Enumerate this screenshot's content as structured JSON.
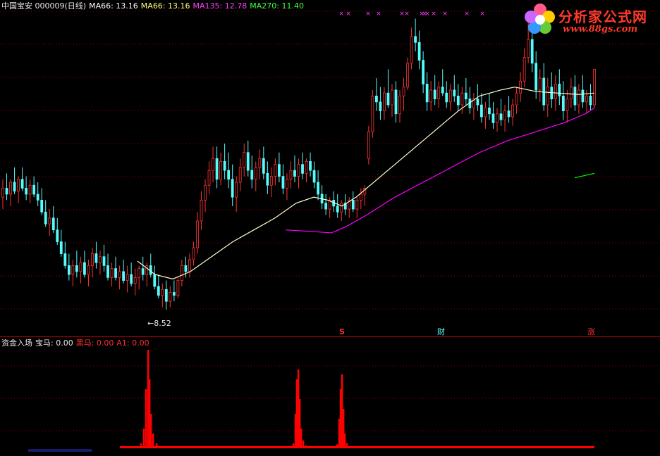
{
  "header": {
    "title": "中国宝安 000009(日线)",
    "ma1": "MA66: 13.16",
    "ma2": "MA66: 13.16",
    "ma3": "MA135: 12.78",
    "ma4": "MA270: 11.40"
  },
  "sub_header": {
    "name": "资金入场",
    "baoma": "宝马: 0.00",
    "heima_label": "黑马",
    "heima": ": 0.00",
    "a1": "A1: 0.00"
  },
  "annotations": {
    "low_price": "←8.52",
    "signal_s": "S",
    "signal_cai": "财",
    "signal_zhang": "涨"
  },
  "logo": {
    "text": "分析家公式网",
    "url": "www.88gs.com"
  },
  "colors": {
    "background": "#000000",
    "up": "#ff3232",
    "down": "#54fcfc",
    "ma_white": "#ffffd0",
    "ma_magenta": "#ff00ff",
    "ma_green": "#00ff00",
    "grid": "#8b0000",
    "volume": "#ff0000"
  },
  "chart_data": {
    "type": "candlestick",
    "ylim": [
      8,
      18.5
    ],
    "low_marker": 8.52,
    "candles": [
      [
        12.3,
        12.9,
        11.9,
        12.6
      ],
      [
        12.6,
        13.1,
        12.2,
        12.4
      ],
      [
        12.4,
        12.9,
        12.0,
        12.8
      ],
      [
        12.8,
        13.3,
        12.4,
        12.5
      ],
      [
        12.5,
        13.0,
        12.1,
        12.9
      ],
      [
        12.9,
        13.3,
        12.5,
        12.6
      ],
      [
        12.6,
        13.0,
        12.2,
        12.4
      ],
      [
        12.4,
        12.9,
        12.1,
        12.7
      ],
      [
        12.7,
        13.0,
        12.3,
        12.4
      ],
      [
        12.4,
        12.8,
        12.0,
        12.2
      ],
      [
        12.2,
        12.6,
        11.7,
        11.8
      ],
      [
        11.8,
        12.2,
        11.3,
        11.4
      ],
      [
        11.4,
        11.9,
        11.0,
        11.6
      ],
      [
        11.6,
        12.0,
        11.1,
        11.2
      ],
      [
        11.2,
        11.6,
        10.7,
        10.8
      ],
      [
        10.8,
        11.2,
        10.3,
        10.4
      ],
      [
        10.4,
        10.8,
        9.9,
        10.0
      ],
      [
        10.0,
        10.4,
        9.5,
        9.7
      ],
      [
        9.7,
        10.2,
        9.3,
        10.0
      ],
      [
        10.0,
        10.5,
        9.6,
        9.8
      ],
      [
        9.8,
        10.3,
        9.4,
        10.1
      ],
      [
        10.1,
        10.5,
        9.6,
        9.7
      ],
      [
        9.7,
        10.2,
        9.3,
        10.0
      ],
      [
        10.0,
        10.6,
        9.6,
        10.4
      ],
      [
        10.4,
        10.8,
        9.9,
        10.1
      ],
      [
        10.1,
        10.5,
        9.7,
        10.3
      ],
      [
        10.3,
        10.7,
        9.8,
        10.0
      ],
      [
        10.0,
        10.4,
        9.5,
        9.6
      ],
      [
        9.6,
        10.1,
        9.3,
        9.9
      ],
      [
        9.9,
        10.3,
        9.5,
        9.6
      ],
      [
        9.6,
        10.0,
        9.2,
        9.8
      ],
      [
        9.8,
        10.2,
        9.4,
        9.5
      ],
      [
        9.5,
        10.0,
        9.1,
        9.7
      ],
      [
        9.7,
        10.1,
        9.3,
        9.4
      ],
      [
        9.4,
        9.9,
        9.0,
        9.6
      ],
      [
        9.6,
        10.0,
        9.2,
        9.9
      ],
      [
        9.9,
        10.3,
        9.5,
        9.7
      ],
      [
        9.7,
        10.1,
        9.3,
        10.0
      ],
      [
        10.0,
        10.4,
        9.6,
        9.7
      ],
      [
        9.7,
        10.0,
        9.2,
        9.3
      ],
      [
        9.3,
        9.7,
        8.9,
        9.0
      ],
      [
        9.0,
        9.4,
        8.6,
        9.2
      ],
      [
        9.2,
        9.5,
        8.52,
        8.8
      ],
      [
        8.8,
        9.3,
        8.6,
        9.1
      ],
      [
        9.1,
        9.5,
        8.8,
        9.0
      ],
      [
        9.0,
        9.6,
        8.9,
        9.5
      ],
      [
        9.5,
        10.2,
        9.3,
        10.0
      ],
      [
        10.0,
        10.3,
        9.6,
        9.8
      ],
      [
        9.8,
        10.4,
        9.6,
        10.2
      ],
      [
        10.2,
        10.8,
        10.0,
        10.6
      ],
      [
        10.6,
        11.8,
        10.4,
        11.5
      ],
      [
        11.5,
        12.5,
        11.2,
        12.2
      ],
      [
        12.2,
        12.9,
        11.8,
        12.7
      ],
      [
        12.7,
        13.5,
        12.4,
        13.2
      ],
      [
        13.2,
        14.0,
        12.8,
        13.6
      ],
      [
        13.6,
        14.0,
        12.6,
        12.9
      ],
      [
        12.9,
        13.8,
        12.7,
        13.5
      ],
      [
        13.5,
        14.1,
        12.9,
        13.2
      ],
      [
        13.2,
        13.8,
        12.6,
        12.9
      ],
      [
        12.9,
        13.4,
        12.0,
        12.3
      ],
      [
        12.3,
        13.0,
        11.8,
        12.8
      ],
      [
        12.8,
        13.6,
        12.5,
        13.3
      ],
      [
        13.3,
        14.1,
        13.0,
        13.8
      ],
      [
        13.8,
        14.2,
        13.0,
        13.2
      ],
      [
        13.2,
        13.7,
        12.6,
        12.9
      ],
      [
        12.9,
        13.5,
        12.5,
        13.3
      ],
      [
        13.3,
        13.9,
        12.9,
        13.6
      ],
      [
        13.6,
        14.0,
        12.9,
        13.1
      ],
      [
        13.1,
        13.5,
        12.4,
        12.7
      ],
      [
        12.7,
        13.3,
        12.3,
        13.0
      ],
      [
        13.0,
        13.6,
        12.7,
        13.4
      ],
      [
        13.4,
        13.8,
        12.8,
        13.0
      ],
      [
        13.0,
        13.4,
        12.4,
        12.6
      ],
      [
        12.6,
        13.1,
        12.2,
        12.9
      ],
      [
        12.9,
        13.5,
        12.6,
        13.2
      ],
      [
        13.2,
        13.7,
        12.8,
        13.0
      ],
      [
        13.0,
        13.6,
        12.6,
        13.4
      ],
      [
        13.4,
        13.8,
        12.9,
        13.1
      ],
      [
        13.1,
        13.6,
        12.8,
        13.5
      ],
      [
        13.5,
        13.8,
        13.0,
        13.2
      ],
      [
        13.2,
        13.5,
        12.6,
        12.8
      ],
      [
        12.8,
        13.2,
        12.2,
        12.4
      ],
      [
        12.4,
        12.7,
        11.9,
        12.1
      ],
      [
        12.1,
        12.4,
        11.7,
        11.9
      ],
      [
        11.9,
        12.3,
        11.6,
        12.2
      ],
      [
        12.2,
        12.5,
        11.8,
        12.0
      ],
      [
        12.0,
        12.4,
        11.6,
        11.8
      ],
      [
        11.8,
        12.2,
        11.5,
        12.1
      ],
      [
        12.1,
        12.4,
        11.7,
        11.9
      ],
      [
        11.9,
        12.3,
        11.6,
        12.2
      ],
      [
        12.2,
        12.5,
        11.8,
        11.9
      ],
      [
        11.9,
        12.3,
        11.6,
        12.2
      ],
      [
        12.2,
        12.6,
        11.9,
        12.4
      ],
      [
        12.4,
        12.7,
        12.0,
        12.6
      ],
      [
        13.6,
        14.7,
        13.4,
        14.5
      ],
      [
        14.5,
        15.9,
        14.3,
        15.7
      ],
      [
        15.7,
        16.3,
        15.2,
        15.5
      ],
      [
        15.5,
        16.0,
        14.9,
        15.2
      ],
      [
        15.2,
        16.0,
        14.9,
        15.8
      ],
      [
        15.8,
        16.6,
        15.3,
        15.4
      ],
      [
        15.4,
        16.1,
        15.0,
        15.9
      ],
      [
        15.9,
        16.2,
        14.8,
        15.1
      ],
      [
        15.1,
        15.9,
        14.8,
        15.7
      ],
      [
        15.7,
        16.3,
        15.2,
        16.0
      ],
      [
        16.0,
        17.0,
        15.9,
        16.8
      ],
      [
        16.8,
        18.0,
        16.6,
        17.7
      ],
      [
        17.7,
        18.3,
        17.2,
        17.5
      ],
      [
        17.5,
        17.9,
        16.6,
        16.9
      ],
      [
        16.9,
        17.2,
        15.8,
        16.1
      ],
      [
        16.1,
        16.5,
        15.2,
        15.5
      ],
      [
        15.5,
        16.2,
        15.2,
        15.9
      ],
      [
        15.9,
        16.4,
        15.4,
        15.6
      ],
      [
        15.6,
        16.2,
        15.3,
        16.0
      ],
      [
        16.0,
        16.6,
        15.7,
        15.8
      ],
      [
        15.8,
        16.2,
        15.3,
        15.5
      ],
      [
        15.5,
        16.1,
        15.2,
        15.9
      ],
      [
        15.9,
        16.4,
        15.5,
        15.7
      ],
      [
        15.7,
        16.1,
        15.2,
        15.4
      ],
      [
        15.4,
        16.0,
        15.1,
        15.8
      ],
      [
        15.8,
        16.3,
        15.4,
        15.6
      ],
      [
        15.6,
        16.0,
        15.1,
        15.3
      ],
      [
        15.3,
        15.8,
        14.9,
        15.6
      ],
      [
        15.6,
        16.1,
        15.2,
        15.4
      ],
      [
        15.4,
        15.8,
        14.8,
        15.0
      ],
      [
        15.0,
        15.5,
        14.6,
        15.3
      ],
      [
        15.3,
        15.8,
        14.9,
        15.1
      ],
      [
        15.1,
        15.5,
        14.6,
        14.8
      ],
      [
        14.8,
        15.3,
        14.5,
        15.1
      ],
      [
        15.1,
        15.6,
        14.7,
        14.9
      ],
      [
        14.9,
        15.4,
        14.5,
        15.2
      ],
      [
        15.2,
        15.7,
        14.8,
        15.0
      ],
      [
        15.0,
        15.6,
        14.7,
        15.4
      ],
      [
        15.4,
        16.0,
        15.1,
        15.8
      ],
      [
        15.8,
        16.5,
        15.5,
        16.2
      ],
      [
        16.2,
        17.3,
        16.0,
        17.0
      ],
      [
        17.0,
        18.4,
        16.8,
        17.6
      ],
      [
        17.6,
        17.9,
        16.5,
        16.8
      ],
      [
        16.8,
        17.2,
        15.6,
        15.9
      ],
      [
        15.9,
        16.6,
        15.5,
        16.3
      ],
      [
        16.3,
        16.8,
        15.2,
        15.4
      ],
      [
        15.4,
        16.3,
        15.0,
        16.0
      ],
      [
        16.0,
        16.5,
        15.3,
        15.6
      ],
      [
        15.6,
        16.4,
        15.2,
        16.1
      ],
      [
        16.1,
        16.6,
        15.4,
        15.7
      ],
      [
        15.7,
        16.2,
        14.9,
        15.2
      ],
      [
        15.2,
        15.9,
        14.8,
        15.6
      ],
      [
        15.6,
        16.3,
        15.3,
        16.0
      ],
      [
        16.0,
        16.4,
        15.2,
        15.4
      ],
      [
        15.4,
        16.1,
        15.1,
        15.9
      ],
      [
        15.9,
        16.4,
        15.3,
        15.5
      ],
      [
        15.5,
        15.9,
        15.1,
        15.7
      ],
      [
        15.7,
        16.1,
        15.2,
        15.4
      ],
      [
        15.4,
        16.2,
        15.3,
        16.6
      ]
    ],
    "ma_white": [
      [
        195,
        10.15
      ],
      [
        220,
        9.7
      ],
      [
        245,
        9.55
      ],
      [
        270,
        9.8
      ],
      [
        300,
        10.3
      ],
      [
        330,
        10.8
      ],
      [
        360,
        11.2
      ],
      [
        390,
        11.6
      ],
      [
        420,
        12.1
      ],
      [
        445,
        12.3
      ],
      [
        465,
        12.2
      ],
      [
        485,
        12.0
      ],
      [
        505,
        12.3
      ],
      [
        530,
        12.8
      ],
      [
        560,
        13.4
      ],
      [
        590,
        14.0
      ],
      [
        620,
        14.6
      ],
      [
        650,
        15.2
      ],
      [
        680,
        15.7
      ],
      [
        710,
        15.9
      ],
      [
        730,
        16.0
      ],
      [
        760,
        15.85
      ],
      [
        790,
        15.8
      ],
      [
        820,
        15.75
      ],
      [
        843,
        15.8
      ]
    ],
    "ma_magenta": [
      [
        405,
        11.2
      ],
      [
        440,
        11.15
      ],
      [
        470,
        11.1
      ],
      [
        490,
        11.3
      ],
      [
        520,
        11.7
      ],
      [
        560,
        12.3
      ],
      [
        600,
        12.8
      ],
      [
        640,
        13.3
      ],
      [
        680,
        13.8
      ],
      [
        720,
        14.2
      ],
      [
        760,
        14.5
      ],
      [
        800,
        14.8
      ],
      [
        830,
        15.1
      ],
      [
        843,
        15.3
      ]
    ],
    "ma_green": [
      [
        815,
        12.95
      ],
      [
        843,
        13.1
      ]
    ],
    "volume": [
      [
        200,
        0.05
      ],
      [
        204,
        0.2
      ],
      [
        207,
        0.6
      ],
      [
        210,
        1.0
      ],
      [
        212,
        0.7
      ],
      [
        214,
        0.35
      ],
      [
        217,
        0.15
      ],
      [
        222,
        0.05
      ],
      [
        416,
        0.05
      ],
      [
        419,
        0.35
      ],
      [
        421,
        0.7
      ],
      [
        423,
        0.8
      ],
      [
        425,
        0.5
      ],
      [
        427,
        0.2
      ],
      [
        430,
        0.08
      ],
      [
        434,
        0.03
      ],
      [
        478,
        0.04
      ],
      [
        481,
        0.3
      ],
      [
        483,
        0.6
      ],
      [
        485,
        0.75
      ],
      [
        487,
        0.4
      ],
      [
        489,
        0.15
      ],
      [
        492,
        0.05
      ],
      [
        496,
        0.02
      ],
      [
        620,
        0.02
      ],
      [
        655,
        0.02
      ]
    ],
    "xmarks": [
      484,
      494,
      522,
      537,
      570,
      577,
      598,
      602,
      606,
      615,
      631,
      662,
      684
    ]
  }
}
